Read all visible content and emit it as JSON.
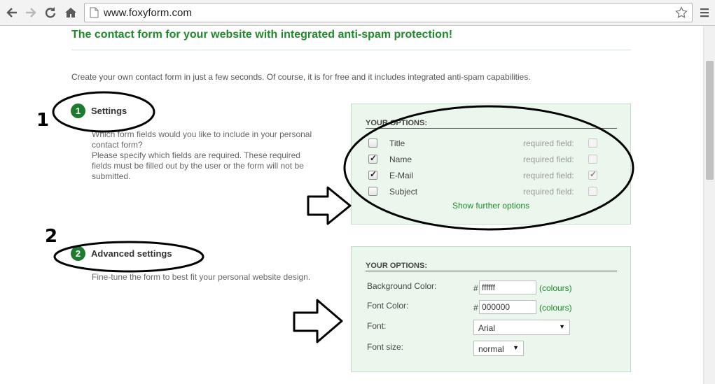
{
  "browser": {
    "url": "www.foxyform.com"
  },
  "page": {
    "headline": "The contact form for your website with integrated anti-spam protection!",
    "intro": "Create your own contact form in just a few seconds. Of course, it is for free and it includes integrated anti-spam capabilities."
  },
  "settings": {
    "number": "1",
    "title": "Settings",
    "desc_1": "Which form fields would you like to include in your personal",
    "desc_2": "contact form?",
    "desc_3": "Please specify which fields are required. These required",
    "desc_4": "fields must be filled out by the user or the form will not be",
    "desc_5": "submitted.",
    "panel_title": "YOUR OPTIONS:",
    "fields": [
      {
        "label": "Title",
        "included": false,
        "required_label": "required field:",
        "required": false
      },
      {
        "label": "Name",
        "included": true,
        "required_label": "required field:",
        "required": false
      },
      {
        "label": "E-Mail",
        "included": true,
        "required_label": "required field:",
        "required": true
      },
      {
        "label": "Subject",
        "included": false,
        "required_label": "required field:",
        "required": false
      }
    ],
    "show_more": "Show further options"
  },
  "advanced": {
    "number": "2",
    "title": "Advanced settings",
    "desc": "Fine-tune the form to best fit your personal website design.",
    "panel_title": "YOUR OPTIONS:",
    "bg_color_label": "Background Color:",
    "bg_color_hash": "#",
    "bg_color_value": "ffffff",
    "bg_colours_link": "(colours)",
    "font_color_label": "Font Color:",
    "font_color_hash": "#",
    "font_color_value": "000000",
    "font_colours_link": "(colours)",
    "font_label": "Font:",
    "font_value": "Arial",
    "font_size_label": "Font size:",
    "font_size_value": "normal"
  },
  "annotations": {
    "num_1": "1",
    "num_2": "2"
  },
  "colors": {
    "accent": "#1f8a2c",
    "badge": "#1d7a2e",
    "panel_bg": "#ebf7ec",
    "panel_border": "#c3dfc6"
  }
}
